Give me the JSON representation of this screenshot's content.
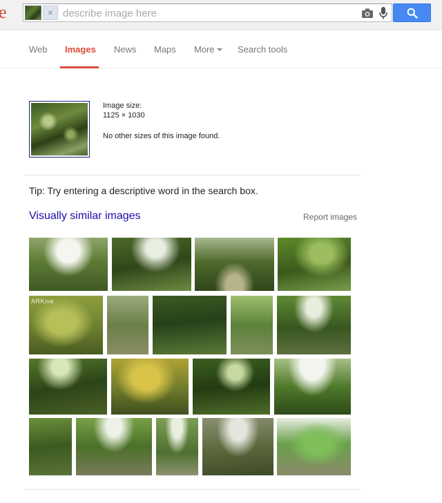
{
  "header": {
    "logo_fragment": "e",
    "search": {
      "value": "",
      "placeholder": "describe image here",
      "chip_close": "×"
    },
    "icons": {
      "camera": "camera-icon",
      "mic": "microphone-icon",
      "search": "magnifier-icon"
    }
  },
  "nav": {
    "tabs": [
      {
        "label": "Web"
      },
      {
        "label": "Images",
        "active": true
      },
      {
        "label": "News"
      },
      {
        "label": "Maps"
      },
      {
        "label": "More"
      },
      {
        "label": "Search tools"
      }
    ]
  },
  "query_image": {
    "size_label": "Image size:",
    "dimensions": "1125 × 1030",
    "other_sizes": "No other sizes of this image found."
  },
  "tip": "Tip: Try entering a descriptive word in the search box.",
  "similar": {
    "title": "Visually similar images",
    "report_label": "Report images",
    "images": [
      {
        "label": ""
      },
      {
        "label": ""
      },
      {
        "label": ""
      },
      {
        "label": ""
      },
      {
        "label": "ARKive"
      },
      {
        "label": ""
      },
      {
        "label": ""
      },
      {
        "label": ""
      },
      {
        "label": ""
      },
      {
        "label": ""
      },
      {
        "label": ""
      },
      {
        "label": ""
      },
      {
        "label": ""
      },
      {
        "label": ""
      },
      {
        "label": ""
      },
      {
        "label": ""
      },
      {
        "label": ""
      },
      {
        "label": ""
      }
    ]
  },
  "colors": {
    "accent_red": "#dd4b39",
    "link_blue": "#1a0dab",
    "button_blue": "#4889f1"
  }
}
